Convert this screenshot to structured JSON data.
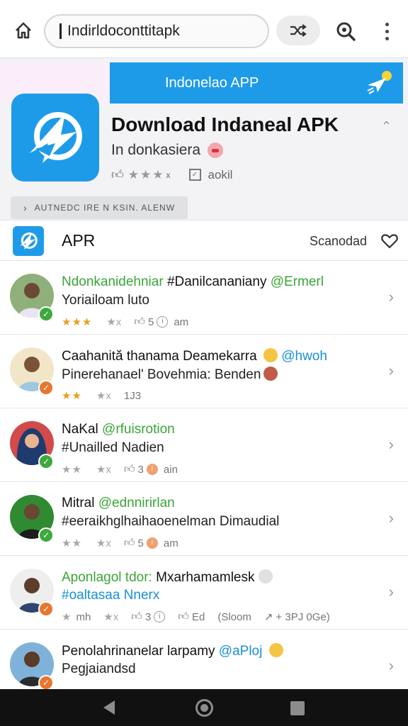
{
  "browser": {
    "url": "Indirldoconttitapk"
  },
  "hero": {
    "banner_text": "Indonelao APP",
    "title": "Download Indaneal APK",
    "subtitle": "In donkasiera",
    "meta_text": "aokil",
    "chip_text": "AUTNEDC IRE N KSIN. ALENW"
  },
  "section": {
    "label": "APR",
    "sort_label": "Scanodad"
  },
  "rows": [
    {
      "line1_green": "Ndonkanidehniar",
      "line1_main": " #Danilcananiany ",
      "line1_tag": "@Ermerl",
      "line2": "Yoriailoam luto",
      "stars": "★★★",
      "stars2": "★x",
      "likes": "5",
      "time": "am",
      "badge_color": "#3ca93a"
    },
    {
      "line1_main": "Caahanită thanama Deamekarra ",
      "line1_tag": "@hwoh",
      "line2": "Pinerehanael' Bovehmia: Benden",
      "stars": "★★",
      "stars2": "★x",
      "time": "1J3",
      "badge_color": "#e8772e"
    },
    {
      "line1_main": "NaKal ",
      "line1_tag": "@rfuisrotion",
      "line2": "#Unailled Nadien",
      "stars": "★★",
      "stars2": "★x",
      "likes": "3",
      "time": "ain",
      "badge_color": "#3ca93a"
    },
    {
      "line1_main": "Mitral ",
      "line1_tag": "@ednnirirlan",
      "line2": "#eeraikhglhaihaoenelman Dimaudial",
      "stars": "★★",
      "stars2": "★x",
      "likes": "5",
      "time": "am",
      "badge_color": "#3ca93a"
    },
    {
      "line1_green": "Aponlagol",
      "line1_tag": " tdor:",
      "line1_main": " Mxarhamamlesk",
      "line2_blue": "#oaltasaa Nnerx",
      "stars": "★",
      "stars_text": "mh",
      "stars2": "★x",
      "likes": "3",
      "extra1": "Ed",
      "extra2": "(Sloom",
      "extra3": "+ 3PJ 0Ge)",
      "badge_color": "#e8772e"
    },
    {
      "line1_main": "Penolahrinanelar larpamy ",
      "line1_tag": "@aPloj",
      "line2": "Pegjaiandsd",
      "badge_color": "#e8772e"
    }
  ]
}
